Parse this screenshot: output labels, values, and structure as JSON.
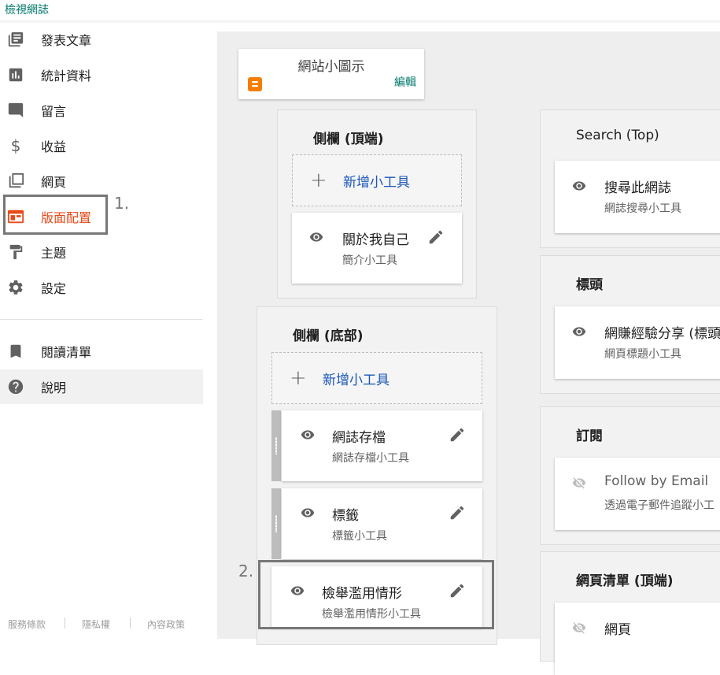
{
  "header": {
    "view_blog": "檢視網誌"
  },
  "sidebar": {
    "items": [
      {
        "label": "發表文章",
        "icon": "posts-icon"
      },
      {
        "label": "統計資料",
        "icon": "stats-icon"
      },
      {
        "label": "留言",
        "icon": "comments-icon"
      },
      {
        "label": "收益",
        "icon": "dollar-icon"
      },
      {
        "label": "網頁",
        "icon": "pages-icon"
      },
      {
        "label": "版面配置",
        "icon": "layout-icon",
        "active": true
      },
      {
        "label": "主題",
        "icon": "paint-roller-icon"
      },
      {
        "label": "設定",
        "icon": "gear-icon"
      }
    ],
    "secondary": [
      {
        "label": "閱讀清單",
        "icon": "bookmark-icon"
      },
      {
        "label": "說明",
        "icon": "help-icon"
      }
    ],
    "footer": {
      "terms": "服務條款",
      "privacy": "隱私權",
      "content_policy": "內容政策"
    }
  },
  "annotations": {
    "one": "1.",
    "two": "2."
  },
  "layout": {
    "favicon": {
      "title": "網站小圖示",
      "edit": "編輯"
    },
    "sidebar_top": {
      "title": "側欄 (頂端)",
      "add_label": "新增小工具",
      "widgets": [
        {
          "title": "關於我自己",
          "subtitle": "簡介小工具",
          "visible": true
        }
      ]
    },
    "sidebar_bottom": {
      "title": "側欄 (底部)",
      "add_label": "新增小工具",
      "widgets": [
        {
          "title": "網誌存檔",
          "subtitle": "網誌存檔小工具",
          "visible": true
        },
        {
          "title": "標籤",
          "subtitle": "標籤小工具",
          "visible": true
        },
        {
          "title": "檢舉濫用情形",
          "subtitle": "檢舉濫用情形小工具",
          "visible": true
        }
      ]
    },
    "search_top": {
      "title": "Search (Top)",
      "widgets": [
        {
          "title": "搜尋此網誌",
          "subtitle": "網誌搜尋小工具",
          "visible": true
        }
      ]
    },
    "header_section": {
      "title": "標頭",
      "widgets": [
        {
          "title": "網賺經驗分享 (標頭",
          "subtitle": "網頁標題小工具",
          "visible": true
        }
      ]
    },
    "subscribe": {
      "title": "訂閱",
      "widgets": [
        {
          "title": "Follow by Email",
          "subtitle": "透過電子郵件追蹤小工",
          "visible": false
        }
      ]
    },
    "pagelist_top": {
      "title": "網頁清單 (頂端)",
      "widgets": [
        {
          "title": "網頁",
          "visible": false
        }
      ]
    }
  },
  "colors": {
    "accent_teal": "#00796b",
    "active_orange": "#e64a19",
    "link_blue": "#1a56b8",
    "blogger_orange": "#f57d00"
  }
}
